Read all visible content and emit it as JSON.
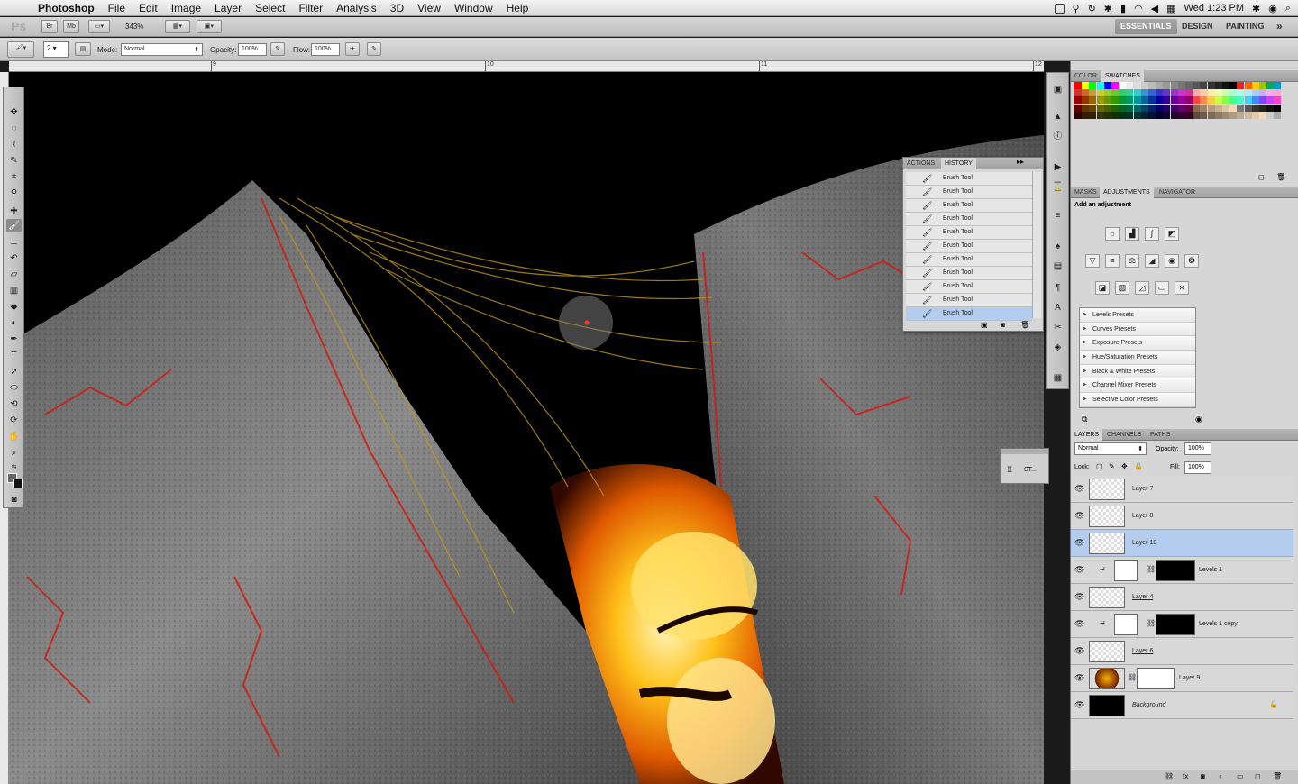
{
  "menubar": {
    "app": "Photoshop",
    "items": [
      "File",
      "Edit",
      "Image",
      "Layer",
      "Select",
      "Filter",
      "Analysis",
      "3D",
      "View",
      "Window",
      "Help"
    ],
    "clock": "Wed 1:23 PM"
  },
  "appbar": {
    "logo": "Ps",
    "zoom": "343%",
    "workspaces": [
      "ESSENTIALS",
      "DESIGN",
      "PAINTING"
    ],
    "more": "»"
  },
  "options": {
    "brush_size": "2",
    "mode_label": "Mode:",
    "mode_value": "Normal",
    "opacity_label": "Opacity:",
    "opacity_value": "100%",
    "flow_label": "Flow:",
    "flow_value": "100%"
  },
  "ruler": {
    "labels": [
      "9",
      "10",
      "11",
      "12"
    ]
  },
  "color_panel": {
    "tabs": [
      "COLOR",
      "SWATCHES"
    ]
  },
  "adjust_panel": {
    "tabs": [
      "MASKS",
      "ADJUSTMENTS",
      "NAVIGATOR"
    ],
    "heading": "Add an adjustment",
    "presets": [
      "Levels Presets",
      "Curves Presets",
      "Exposure Presets",
      "Hue/Saturation Presets",
      "Black & White Presets",
      "Channel Mixer Presets",
      "Selective Color Presets"
    ]
  },
  "history_panel": {
    "tabs": [
      "ACTIONS",
      "HISTORY"
    ],
    "items": [
      "Brush Tool",
      "Brush Tool",
      "Brush Tool",
      "Brush Tool",
      "Brush Tool",
      "Brush Tool",
      "Brush Tool",
      "Brush Tool",
      "Brush Tool",
      "Brush Tool",
      "Brush Tool"
    ]
  },
  "mini_panel": {
    "label": "ST..."
  },
  "layers_panel": {
    "tabs": [
      "LAYERS",
      "CHANNELS",
      "PATHS"
    ],
    "blend": "Normal",
    "opacity_label": "Opacity:",
    "opacity_value": "100%",
    "lock_label": "Lock:",
    "fill_label": "Fill:",
    "fill_value": "100%",
    "layers": [
      "Layer 7",
      "Layer 8",
      "Layer 10",
      "Levels 1",
      "Layer 4",
      "Levels 1 copy",
      "Layer 6",
      "Layer 9",
      "Background"
    ]
  },
  "colors": {
    "selection": "#b4cdee",
    "panel": "#d6d6d6",
    "lava": "#ffb000"
  }
}
